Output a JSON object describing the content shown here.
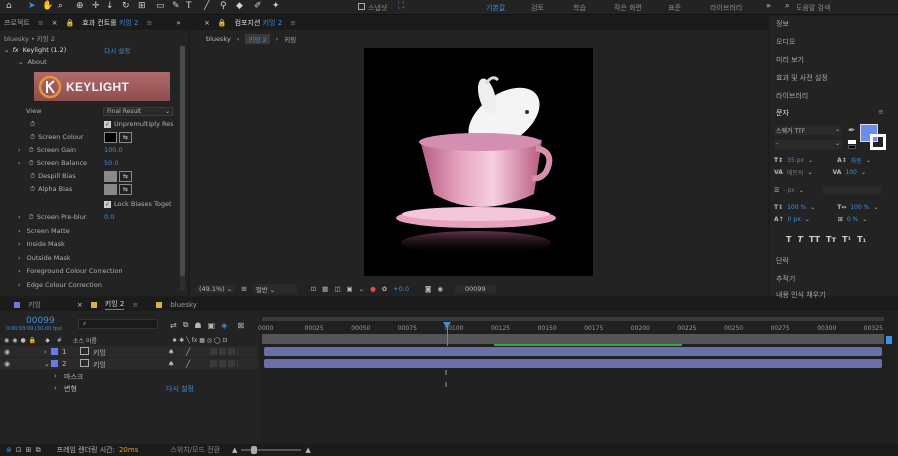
{
  "toolbar": {
    "snap_label": "스냅샷",
    "workspaces": [
      "기본값",
      "검토",
      "학습",
      "작은 화면",
      "표준",
      "라이브러리"
    ],
    "active_workspace": "기본값",
    "search_placeholder": "도움말 검색"
  },
  "left_panel": {
    "tabs": [
      "프로젝트",
      "효과 컨트롤"
    ],
    "active_tab_target": "키잉 2",
    "breadcrumb": "bluesky • 키잉 2",
    "effect": {
      "name": "Keylight (1.2)",
      "reset": "다시 설정"
    },
    "about": "About",
    "logo_text": "KEYLIGHT",
    "view_label": "View",
    "view_value": "Final Result",
    "unpremultiply": "Unpremultiply Res",
    "screen_colour": "Screen Colour",
    "screen_gain": {
      "label": "Screen Gain",
      "value": "100.0"
    },
    "screen_balance": {
      "label": "Screen Balance",
      "value": "50.0"
    },
    "despill_bias": "Despill Bias",
    "alpha_bias": "Alpha Bias",
    "lock_biases": "Lock Biases Toget",
    "screen_preblur": {
      "label": "Screen Pre-blur",
      "value": "0.0"
    },
    "groups": [
      "Screen Matte",
      "Inside Mask",
      "Outside Mask",
      "Foreground Colour Correction",
      "Edge Colour Correction"
    ]
  },
  "center_panel": {
    "tab_label": "컴포지션",
    "tab_target": "키잉 2",
    "breadcrumb_root": "bluesky",
    "breadcrumb_current": "키잉 2",
    "breadcrumb_next": "키잉",
    "zoom": "(49.1%)",
    "resolution": "절반",
    "exposure": "+0.0",
    "timecode": "00099"
  },
  "right_panel": {
    "items": [
      "정보",
      "오디오",
      "미리 보기",
      "효과 및 사전 설정",
      "라이브러리"
    ],
    "character": "문자",
    "font": "스웨거 TTF",
    "font_style": "-",
    "size": "35 px",
    "leading": "자동",
    "kerning": "메트릭",
    "tracking": "100",
    "stroke": "- px",
    "vert_scale": "100 %",
    "horiz_scale": "100 %",
    "baseline": "0 px",
    "tsume": "0 %",
    "paragraph": "단락",
    "tracker": "추적기",
    "content_aware": "내용 인식 채우기"
  },
  "timeline": {
    "tabs": [
      "키잉",
      "키잉 2",
      "bluesky"
    ],
    "active_tab": "키잉 2",
    "timecode": "00099",
    "sub_timecode": "0:00:03:09 (30.00 fps)",
    "search_placeholder": "",
    "header_num": "#",
    "header_source": "소스 이름",
    "ruler": [
      "0000",
      "00025",
      "00050",
      "00075",
      "00100",
      "00125",
      "00150",
      "00175",
      "00200",
      "00225",
      "00250",
      "00275",
      "00300",
      "00325"
    ],
    "layers": [
      {
        "num": "1",
        "name": "키잉"
      },
      {
        "num": "2",
        "name": "키잉"
      }
    ],
    "sublayers": [
      "마스크",
      "변형"
    ],
    "reset": "다시 설정"
  },
  "status": {
    "render_label": "프레임 렌더링 시간:",
    "render_value": "20ms",
    "toggle_label": "스위치/모드 전환"
  },
  "colors": {
    "accent": "#3d8fe0",
    "layer_bar": "#6a6fa8",
    "cup_pink": "#e8a9c3",
    "logo_bg": "#a86262"
  }
}
